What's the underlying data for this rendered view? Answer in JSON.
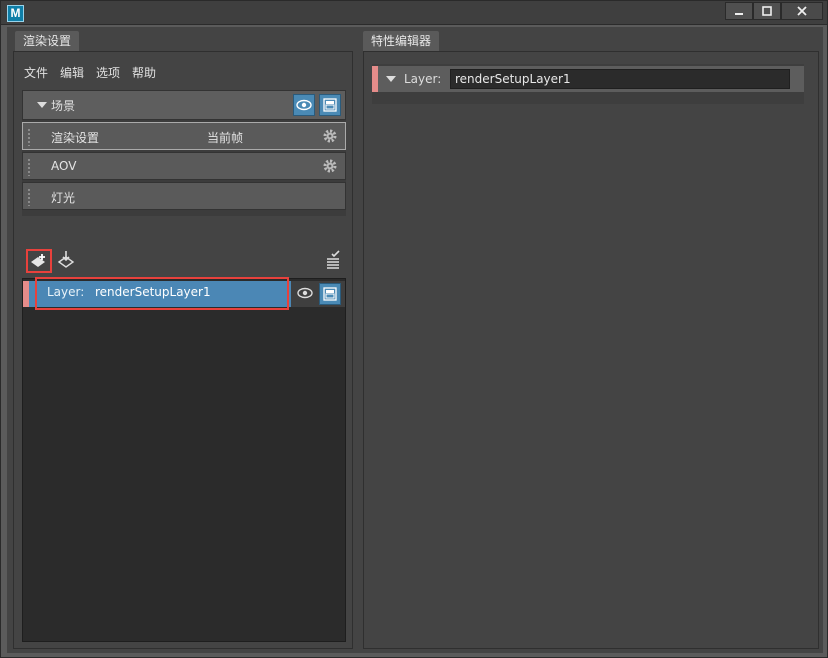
{
  "window": {
    "app_icon_letter": "M",
    "buttons": {
      "minimize": "▬",
      "maximize": "□",
      "close": "✕"
    }
  },
  "left_panel": {
    "tab_label": "渲染设置",
    "menu": [
      "文件",
      "编辑",
      "选项",
      "帮助"
    ],
    "scene": {
      "label": "场景",
      "rows": [
        {
          "label": "渲染设置",
          "extra": "当前帧",
          "icon": "gear-icon"
        },
        {
          "label": "AOV",
          "extra": "",
          "icon": "gear-icon"
        },
        {
          "label": "灯光",
          "extra": "",
          "icon": ""
        }
      ]
    },
    "layers": [
      {
        "prefix": "Layer:",
        "name": "renderSetupLayer1"
      }
    ]
  },
  "right_panel": {
    "tab_label": "特性编辑器",
    "attr_label": "Layer:",
    "attr_value": "renderSetupLayer1"
  },
  "colors": {
    "accent_blue": "#4b87b5",
    "layer_marker": "#e58c8a",
    "highlight_red": "#e8413c"
  }
}
